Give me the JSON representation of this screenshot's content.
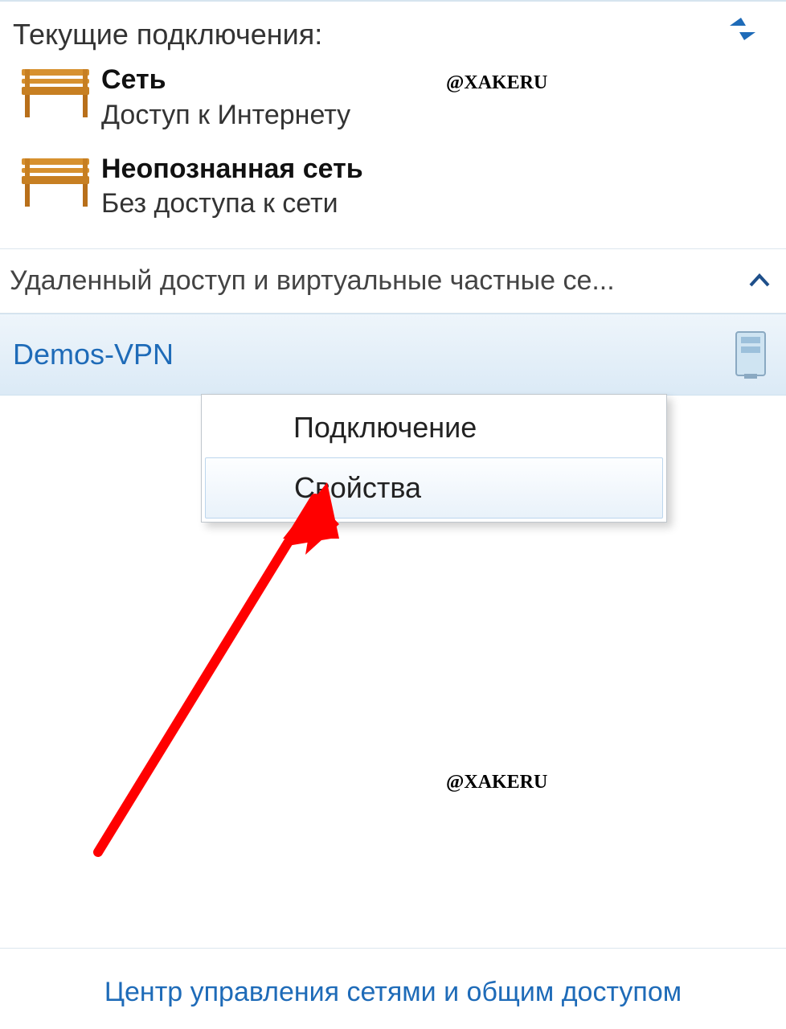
{
  "header": {
    "title": "Текущие подключения:"
  },
  "watermark": "@XAKERU",
  "networks": [
    {
      "name": "Сеть",
      "status": "Доступ к Интернету"
    },
    {
      "name": "Неопознанная сеть",
      "status": "Без доступа к сети"
    }
  ],
  "section": {
    "title": "Удаленный доступ и виртуальные частные се..."
  },
  "vpn": {
    "name": "Demos-VPN"
  },
  "context_menu": {
    "items": [
      "Подключение",
      "Свойства"
    ],
    "highlighted_index": 1
  },
  "footer": {
    "link": "Центр управления сетями и общим доступом"
  }
}
